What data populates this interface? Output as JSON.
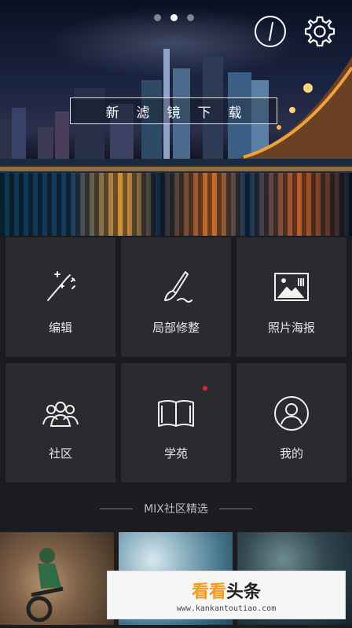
{
  "hero": {
    "carousel_count": 3,
    "carousel_active_index": 1,
    "banner_text": "新滤镜下载"
  },
  "grid": {
    "tiles": [
      {
        "label": "编辑",
        "icon": "magic-wand-icon"
      },
      {
        "label": "局部修整",
        "icon": "brush-icon"
      },
      {
        "label": "照片海报",
        "icon": "poster-icon"
      },
      {
        "label": "社区",
        "icon": "community-icon",
        "badge": false
      },
      {
        "label": "学苑",
        "icon": "book-icon",
        "badge": true
      },
      {
        "label": "我的",
        "icon": "profile-icon",
        "badge": false
      }
    ]
  },
  "section": {
    "title": "MIX社区精选"
  },
  "watermark": {
    "title_a": "看看",
    "title_b": "头条",
    "url": "www.kankantoutiao.com"
  },
  "colors": {
    "badge": "#e02525",
    "tile_bg": "#2a2b2f",
    "bg": "#1b1c1f"
  }
}
